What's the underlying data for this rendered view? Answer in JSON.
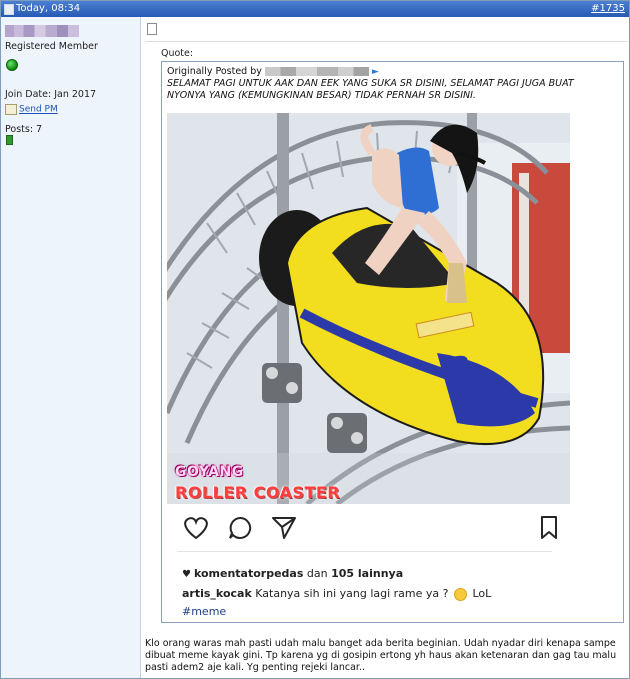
{
  "header": {
    "timestamp": "Today, 08:34",
    "post_number": "#1735"
  },
  "sidebar": {
    "user_title": "Registered Member",
    "join_date": "Join Date: Jan 2017",
    "send_pm": "Send PM",
    "posts": "Posts: 7"
  },
  "post": {
    "quote_label": "Quote:",
    "originally_posted_by": "Originally Posted by",
    "quote_text": "SELAMAT PAGI UNTUK AAK DAN EEK YANG SUKA SR DISINI, SELAMAT PAGI JUGA BUAT NYONYA YANG (KEMUNGKINAN BESAR) TIDAK PERNAH SR DISINI.",
    "meme_text_top": "GOYANG",
    "meme_text_bottom": "ROLLER COASTER",
    "instagram": {
      "likes_user": "komentatorpedas",
      "likes_mid": " dan ",
      "likes_count": "105 lainnya",
      "caption_user": "artis_kocak",
      "caption_text": " Katanya sih ini yang lagi rame ya ? ",
      "caption_end": " LoL",
      "hashtag": "#meme"
    },
    "body": "Klo orang waras mah pasti udah malu banget ada berita beginian. Udah nyadar diri kenapa sampe dibuat meme kayak gini. Tp karena yg di gosipin ertong yh haus akan ketenaran dan gag tau malu pasti adem2 aje kali. Yg penting rejeki lancar.."
  },
  "colors": {
    "header_bg": "#2759b4",
    "sidebar_bg": "#eef4fc",
    "link": "#2050b0",
    "online": "#0a8a0a"
  }
}
